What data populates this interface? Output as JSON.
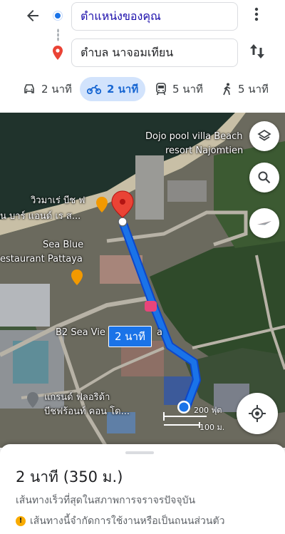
{
  "search": {
    "origin_value": "ตำแหน่งของคุณ",
    "destination_value": "ตำบล นาจอมเทียน"
  },
  "icons": {
    "back": "arrow-left-icon",
    "more": "more-vert-icon",
    "swap": "swap-vert-icon",
    "layers": "layers-icon",
    "search": "search-icon",
    "compass": "compass-icon",
    "my_location": "my-location-icon"
  },
  "modes": [
    {
      "icon": "car-icon",
      "label": "2 นาที",
      "active": false
    },
    {
      "icon": "motorcycle-icon",
      "label": "2 นาที",
      "active": true
    },
    {
      "icon": "transit-icon",
      "label": "5 นาที",
      "active": false
    },
    {
      "icon": "walk-icon",
      "label": "5 นาที",
      "active": false
    }
  ],
  "map": {
    "labels": {
      "dojo_1": "Dojo pool villa Beach",
      "dojo_2": "resort Najomtien",
      "wimarn_1": "วิวมาเร่ บีช ฟ",
      "wimarn_2": "น บาร์ แอนด์ เร ส...",
      "seablue_1": "Sea Blue",
      "seablue_2": "estaurant Pattaya",
      "b2": "B2 Sea Vie",
      "b2_tail": "a",
      "grand_1": "แกรนด์ ฟลอริด้า",
      "grand_2": "บีชฟร้อนท์ คอน โด..."
    },
    "route_badge": "2 นาที",
    "scale": {
      "ft": "200 ฟุต",
      "m": "100 ม."
    }
  },
  "colors": {
    "route": "#1a73e8",
    "accent": "#1a73e8",
    "active_mode_bg": "#d2e3fc",
    "destination_pin": "#ea4335"
  },
  "sheet": {
    "eta_time": "2 นาที",
    "eta_distance": "(350 ม.)",
    "subtitle": "เส้นทางเร็วที่สุดในสภาพการจราจรปัจจุบัน",
    "warning": "เส้นทางนี้จำกัดการใช้งานหรือเป็นถนนส่วนตัว"
  }
}
